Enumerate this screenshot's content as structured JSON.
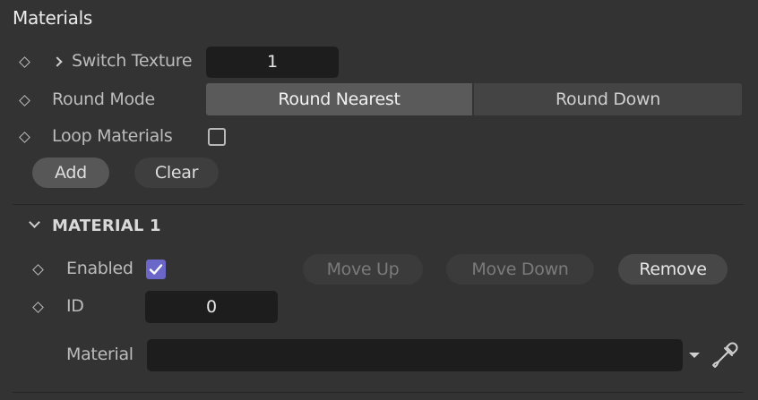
{
  "panel": {
    "title": "Materials"
  },
  "switch_texture": {
    "label": "Switch Texture",
    "value": "1"
  },
  "round_mode": {
    "label": "Round Mode",
    "options": [
      "Round Nearest",
      "Round Down"
    ],
    "selected": "Round Nearest"
  },
  "loop_materials": {
    "label": "Loop Materials",
    "checked": false
  },
  "buttons": {
    "add": "Add",
    "clear": "Clear"
  },
  "material_section": {
    "title": "MATERIAL 1",
    "enabled": {
      "label": "Enabled",
      "checked": true
    },
    "move_up": "Move Up",
    "move_down": "Move Down",
    "remove": "Remove",
    "id": {
      "label": "ID",
      "value": "0"
    },
    "material": {
      "label": "Material",
      "value": ""
    }
  },
  "colors": {
    "accent": "#6b67c8",
    "background": "#333333",
    "field": "#1d1d1d"
  },
  "icons": [
    "diamond-icon",
    "chevron-right-icon",
    "chevron-down-icon",
    "check-icon",
    "dropdown-arrow-icon",
    "eyedropper-icon"
  ]
}
